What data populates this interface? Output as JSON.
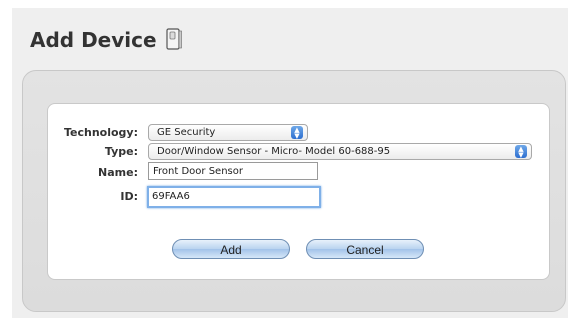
{
  "header": {
    "title": "Add Device",
    "icon": "door-sensor-icon"
  },
  "form": {
    "technology": {
      "label": "Technology:",
      "value": "GE Security"
    },
    "type": {
      "label": "Type:",
      "value": "Door/Window Sensor - Micro- Model 60-688-95"
    },
    "name": {
      "label": "Name:",
      "value": "Front Door Sensor"
    },
    "id": {
      "label": "ID:",
      "value": "69FAA6"
    }
  },
  "buttons": {
    "add_label": "Add",
    "cancel_label": "Cancel"
  }
}
